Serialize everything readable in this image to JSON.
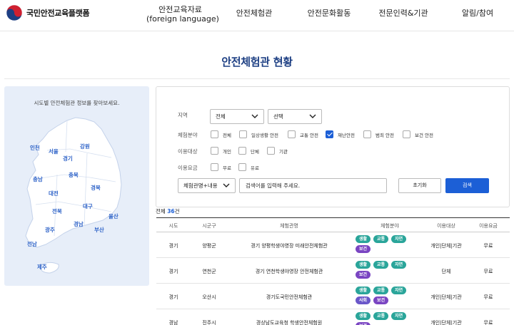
{
  "header": {
    "logo_text": "국민안전교육플랫폼",
    "nav": [
      {
        "label": "안전교육자료",
        "sub": "(foreign language)"
      },
      {
        "label": "안전체험관",
        "sub": ""
      },
      {
        "label": "안전문화활동",
        "sub": ""
      },
      {
        "label": "전문인력&기관",
        "sub": ""
      },
      {
        "label": "알림/참여",
        "sub": ""
      }
    ]
  },
  "page_title": "안전체험관 현황",
  "map": {
    "caption": "시도별 안전체험관 정보를 찾아보세요.",
    "regions": [
      "인천",
      "서울",
      "강원",
      "경기",
      "충남",
      "충북",
      "경북",
      "대전",
      "전북",
      "대구",
      "울산",
      "경남",
      "광주",
      "부산",
      "전남",
      "제주"
    ]
  },
  "filters": {
    "region_label": "지역",
    "region_select1": "전체",
    "region_select2": "선택",
    "field_label": "체험분야",
    "fields": [
      {
        "label": "전체",
        "checked": false
      },
      {
        "label": "일상생활 안전",
        "checked": false
      },
      {
        "label": "교통 안전",
        "checked": false
      },
      {
        "label": "재난안전",
        "checked": true
      },
      {
        "label": "범죄 안전",
        "checked": false
      },
      {
        "label": "보건 안전",
        "checked": false
      }
    ],
    "target_label": "이용대상",
    "targets": [
      {
        "label": "개인",
        "checked": false
      },
      {
        "label": "단체",
        "checked": false
      },
      {
        "label": "기관",
        "checked": false
      }
    ],
    "fee_label": "이용요금",
    "fees": [
      {
        "label": "무료",
        "checked": false
      },
      {
        "label": "유료",
        "checked": false
      }
    ],
    "search_scope": "체험관명+내용",
    "search_placeholder": "검색어를 입력해 주세요.",
    "reset_label": "초기화",
    "search_label": "검색"
  },
  "total": {
    "prefix": "전체 ",
    "count": "36",
    "suffix": "건"
  },
  "table": {
    "headers": [
      "시도",
      "시군구",
      "체험관명",
      "체험분야",
      "이용대상",
      "이용요금"
    ],
    "rows": [
      {
        "sido": "경기",
        "sigungu": "양평군",
        "name": "경기 양평학생야영장 미래안전체험관",
        "tags": [
          "생활",
          "교통",
          "자연",
          "보건"
        ],
        "target": "개인|단체|기관",
        "fee": "무료"
      },
      {
        "sido": "경기",
        "sigungu": "연천군",
        "name": "경기 연천학생야영장 안전체험관",
        "tags": [
          "생활",
          "교통",
          "자연",
          "보건"
        ],
        "target": "단체",
        "fee": "무료"
      },
      {
        "sido": "경기",
        "sigungu": "오산시",
        "name": "경기도국민안전체험관",
        "tags": [
          "생활",
          "교통",
          "자연",
          "사회",
          "보건"
        ],
        "target": "개인|단체|기관",
        "fee": "무료"
      },
      {
        "sido": "경남",
        "sigungu": "진주시",
        "name": "경상남도교육청 학생안전체험원",
        "tags": [
          "생활",
          "교통",
          "자연",
          "보건"
        ],
        "target": "개인|단체|기관",
        "fee": "무료"
      }
    ]
  },
  "tag_colors": {
    "생활": "#2aa59a",
    "교통": "#2aa59a",
    "자연": "#2aa59a",
    "사회": "#6a57c9",
    "보건": "#7a45c2"
  },
  "colors": {
    "accent": "#1c5fd6",
    "title": "#1d3f83",
    "map_bg": "#e7eef9"
  }
}
